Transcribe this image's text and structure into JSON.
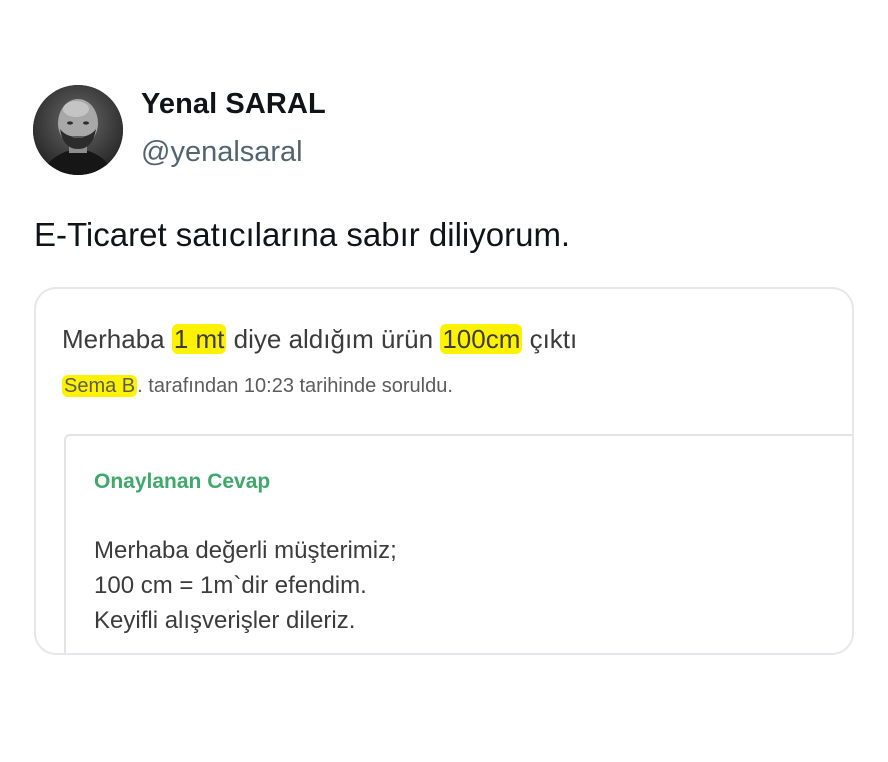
{
  "tweet": {
    "author": {
      "name": "Yenal SARAL",
      "handle": "@yenalsaral",
      "avatar_icon": "user-avatar-photo"
    },
    "text": "E-Ticaret satıcılarına sabır diliyorum."
  },
  "card": {
    "question": {
      "part1": "Merhaba ",
      "highlight1": "1 mt",
      "part2": " diye aldığım ürün ",
      "highlight2": "100cm",
      "part3": " çıktı"
    },
    "meta": {
      "author_highlight": "Sema B",
      "rest": ". tarafından 10:23 tarihinde soruldu."
    },
    "answer": {
      "title": "Onaylanan Cevap",
      "lines": [
        "Merhaba değerli müşterimiz;",
        "100 cm = 1m`dir efendim.",
        "Keyifli alışverişler dileriz."
      ]
    },
    "colors": {
      "highlight": "#fff200",
      "answer_title": "#3fa86b"
    }
  }
}
